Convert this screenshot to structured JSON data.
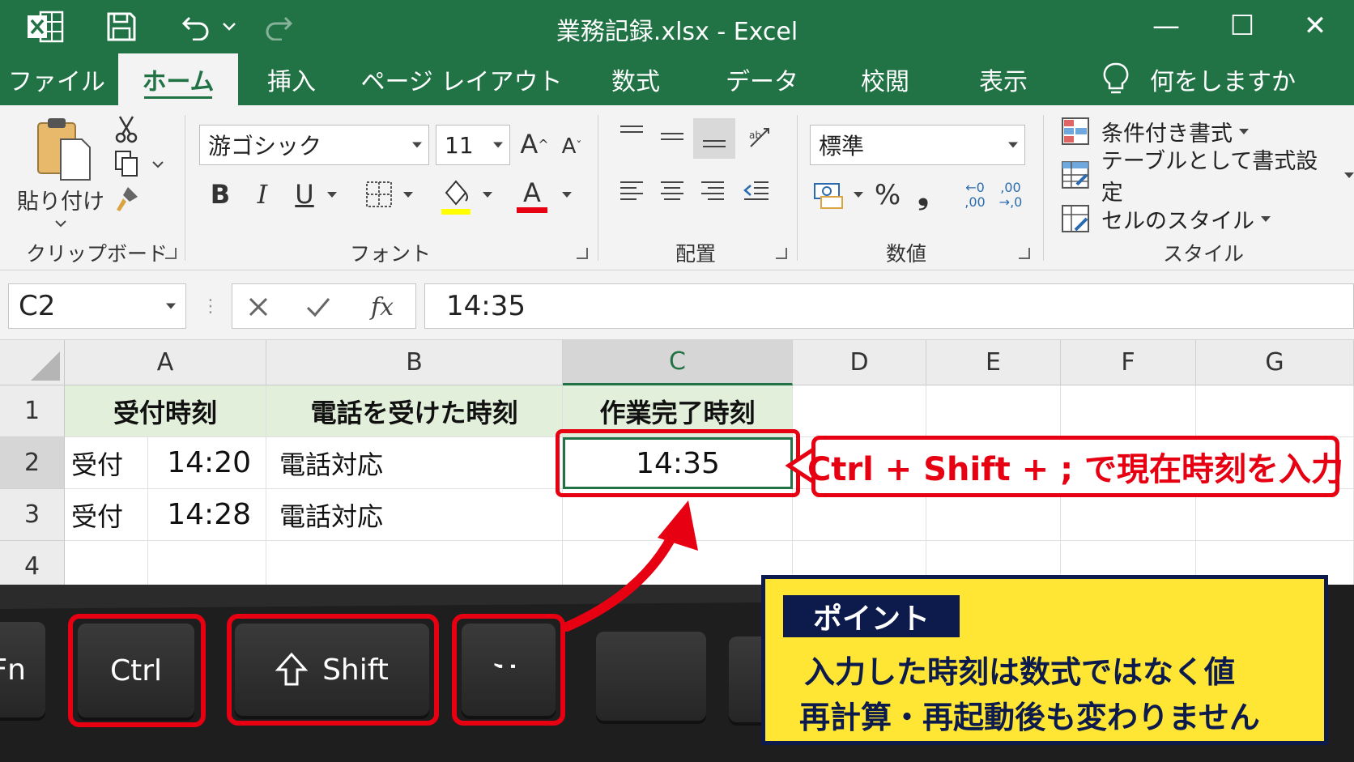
{
  "titlebar": {
    "title": "業務記録.xlsx  -  Excel",
    "icons": [
      "excel-logo",
      "save-icon",
      "undo-icon",
      "redo-icon"
    ],
    "minimize": "—",
    "maximize": "☐",
    "close": "✕"
  },
  "menu": {
    "tabs": [
      "ファイル",
      "ホーム",
      "挿入",
      "ページ レイアウト",
      "数式",
      "データ",
      "校閲",
      "表示"
    ],
    "active": "ホーム",
    "tell_me": "何をしますか"
  },
  "ribbon": {
    "clipboard": {
      "paste_label": "貼り付け",
      "group_label": "クリップボード"
    },
    "font": {
      "font_name": "游ゴシック",
      "font_size": "11",
      "group_label": "フォント",
      "bold": "B",
      "italic": "I",
      "underline": "U",
      "grow": "A",
      "shrink": "A",
      "font_color_glyph": "A"
    },
    "alignment": {
      "group_label": "配置"
    },
    "number": {
      "format": "標準",
      "percent": "%",
      "comma": "❟",
      "inc_decimal": "←0 ,00",
      "dec_decimal": ",00 →,0",
      "group_label": "数値"
    },
    "styles": {
      "conditional": "条件付き書式",
      "table": "テーブルとして書式設定",
      "cell_styles": "セルのスタイル",
      "group_label": "スタイル"
    },
    "colors": {
      "highlight": "#ffff00",
      "font_color": "#e60012"
    }
  },
  "formula_bar": {
    "name_box": "C2",
    "fx": "fx",
    "value": "14:35"
  },
  "sheet": {
    "columns": [
      "A",
      "B",
      "C",
      "D",
      "E",
      "F",
      "G"
    ],
    "selected_column": "C",
    "rows": [
      "1",
      "2",
      "3",
      "4"
    ],
    "headers": {
      "a": "受付時刻",
      "b": "電話を受けた時刻",
      "c": "作業完了時刻"
    },
    "row2": {
      "a1": "受付",
      "a2": "14:20",
      "b": "電話対応",
      "c": "14:35"
    },
    "row3": {
      "a1": "受付",
      "a2": "14:28",
      "b": "電話対応"
    },
    "header_fill": "#e2efda",
    "accent": "#217346"
  },
  "keyboard": {
    "fn": "Fn",
    "ctrl": "Ctrl",
    "shift": "Shift",
    "semicolon": ";",
    "highlight_color": "#e60012"
  },
  "callout": {
    "text": "Ctrl + Shift + ; で現在時刻を入力"
  },
  "point": {
    "tag": "ポイント",
    "line1": "入力した時刻は数式ではなく値",
    "line2": "再計算・再起動後も変わりません"
  }
}
